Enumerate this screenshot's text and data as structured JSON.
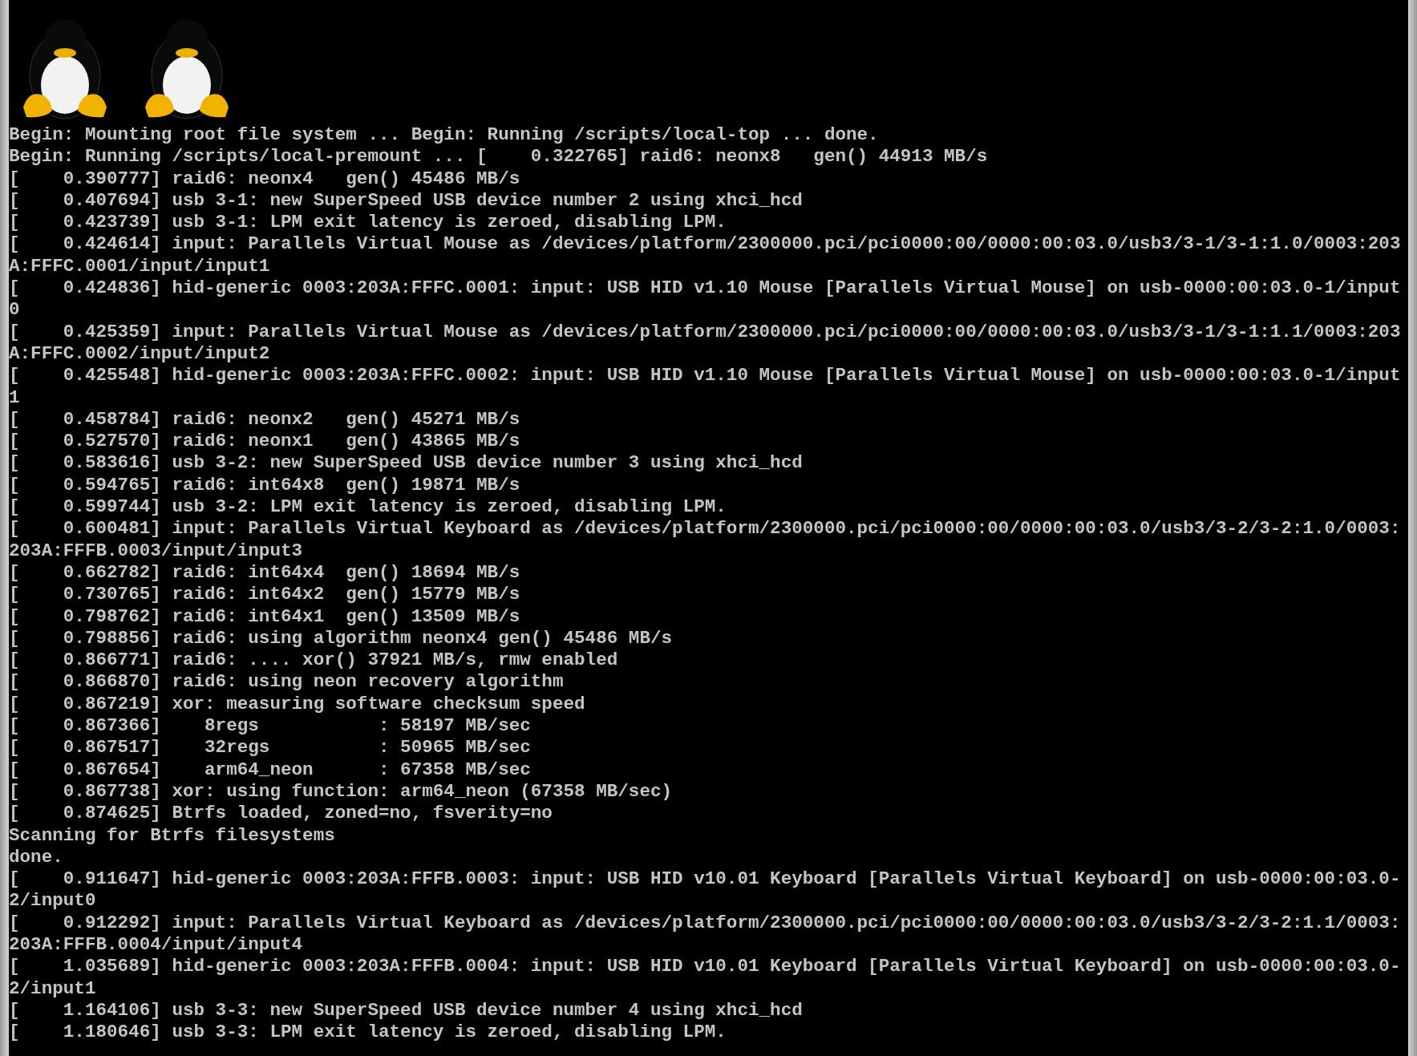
{
  "console": {
    "logos": [
      {
        "kind": "penguin"
      },
      {
        "kind": "penguin"
      }
    ],
    "lines": [
      "Begin: Mounting root file system ... Begin: Running /scripts/local-top ... done.",
      "Begin: Running /scripts/local-premount ... [    0.322765] raid6: neonx8   gen() 44913 MB/s",
      "[    0.390777] raid6: neonx4   gen() 45486 MB/s",
      "[    0.407694] usb 3-1: new SuperSpeed USB device number 2 using xhci_hcd",
      "[    0.423739] usb 3-1: LPM exit latency is zeroed, disabling LPM.",
      "[    0.424614] input: Parallels Virtual Mouse as /devices/platform/2300000.pci/pci0000:00/0000:00:03.0/usb3/3-1/3-1:1.0/0003:203",
      "A:FFFC.0001/input/input1",
      "[    0.424836] hid-generic 0003:203A:FFFC.0001: input: USB HID v1.10 Mouse [Parallels Virtual Mouse] on usb-0000:00:03.0-1/input",
      "0",
      "[    0.425359] input: Parallels Virtual Mouse as /devices/platform/2300000.pci/pci0000:00/0000:00:03.0/usb3/3-1/3-1:1.1/0003:203",
      "A:FFFC.0002/input/input2",
      "[    0.425548] hid-generic 0003:203A:FFFC.0002: input: USB HID v1.10 Mouse [Parallels Virtual Mouse] on usb-0000:00:03.0-1/input",
      "1",
      "[    0.458784] raid6: neonx2   gen() 45271 MB/s",
      "[    0.527570] raid6: neonx1   gen() 43865 MB/s",
      "[    0.583616] usb 3-2: new SuperSpeed USB device number 3 using xhci_hcd",
      "[    0.594765] raid6: int64x8  gen() 19871 MB/s",
      "[    0.599744] usb 3-2: LPM exit latency is zeroed, disabling LPM.",
      "[    0.600481] input: Parallels Virtual Keyboard as /devices/platform/2300000.pci/pci0000:00/0000:00:03.0/usb3/3-2/3-2:1.0/0003:",
      "203A:FFFB.0003/input/input3",
      "[    0.662782] raid6: int64x4  gen() 18694 MB/s",
      "[    0.730765] raid6: int64x2  gen() 15779 MB/s",
      "[    0.798762] raid6: int64x1  gen() 13509 MB/s",
      "[    0.798856] raid6: using algorithm neonx4 gen() 45486 MB/s",
      "[    0.866771] raid6: .... xor() 37921 MB/s, rmw enabled",
      "[    0.866870] raid6: using neon recovery algorithm",
      "[    0.867219] xor: measuring software checksum speed",
      "[    0.867366]    8regs           : 58197 MB/sec",
      "[    0.867517]    32regs          : 50965 MB/sec",
      "[    0.867654]    arm64_neon      : 67358 MB/sec",
      "[    0.867738] xor: using function: arm64_neon (67358 MB/sec)",
      "[    0.874625] Btrfs loaded, zoned=no, fsverity=no",
      "Scanning for Btrfs filesystems",
      "done.",
      "[    0.911647] hid-generic 0003:203A:FFFB.0003: input: USB HID v10.01 Keyboard [Parallels Virtual Keyboard] on usb-0000:00:03.0-",
      "2/input0",
      "[    0.912292] input: Parallels Virtual Keyboard as /devices/platform/2300000.pci/pci0000:00/0000:00:03.0/usb3/3-2/3-2:1.1/0003:",
      "203A:FFFB.0004/input/input4",
      "[    1.035689] hid-generic 0003:203A:FFFB.0004: input: USB HID v10.01 Keyboard [Parallels Virtual Keyboard] on usb-0000:00:03.0-",
      "2/input1",
      "[    1.164106] usb 3-3: new SuperSpeed USB device number 4 using xhci_hcd",
      "[    1.180646] usb 3-3: LPM exit latency is zeroed, disabling LPM."
    ]
  }
}
